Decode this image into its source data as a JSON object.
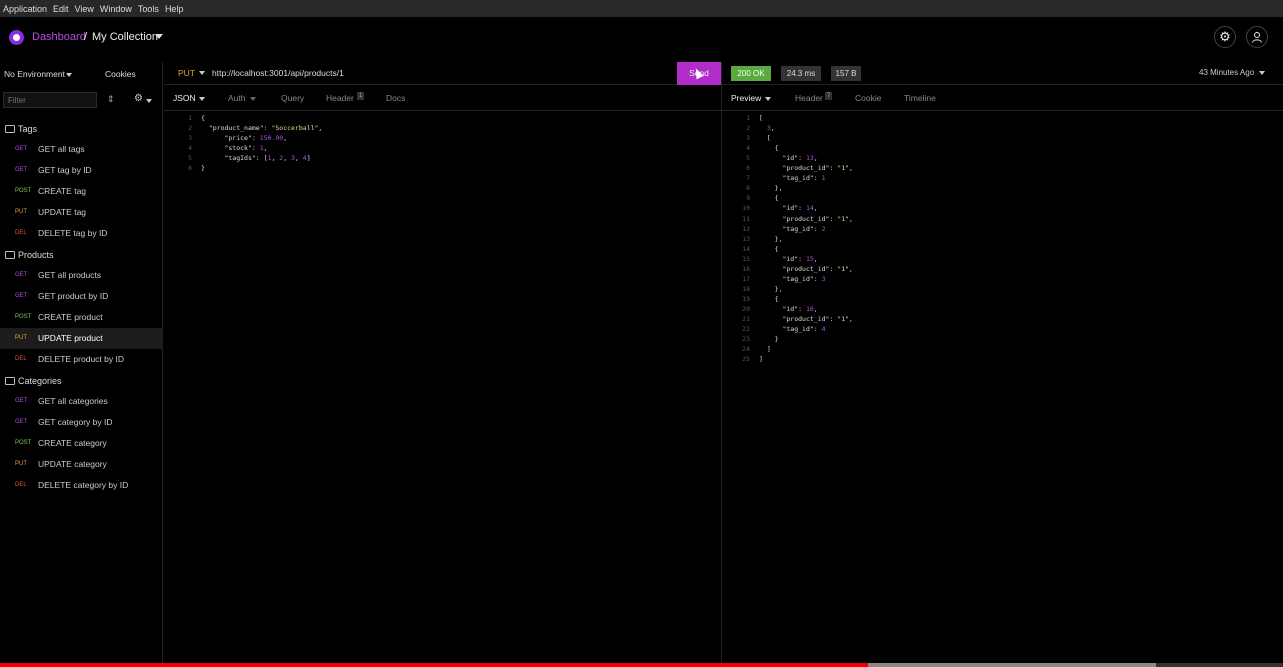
{
  "menu": [
    "Application",
    "Edit",
    "View",
    "Window",
    "Tools",
    "Help"
  ],
  "breadcrumb": {
    "dashboard": "Dashboard",
    "separator": "/",
    "collection": "My Collection"
  },
  "topbar": {
    "settings_icon": "gear-icon",
    "account_icon": "user-icon"
  },
  "sidebar": {
    "environment": "No Environment",
    "cookies": "Cookies",
    "filter_placeholder": "Filter",
    "folders": [
      {
        "name": "Tags",
        "requests": [
          {
            "method": "GET",
            "label": "GET all tags"
          },
          {
            "method": "GET",
            "label": "GET tag by ID"
          },
          {
            "method": "POST",
            "label": "CREATE tag"
          },
          {
            "method": "PUT",
            "label": "UPDATE tag"
          },
          {
            "method": "DEL",
            "label": "DELETE tag by ID"
          }
        ]
      },
      {
        "name": "Products",
        "requests": [
          {
            "method": "GET",
            "label": "GET all products"
          },
          {
            "method": "GET",
            "label": "GET product by ID"
          },
          {
            "method": "POST",
            "label": "CREATE product"
          },
          {
            "method": "PUT",
            "label": "UPDATE product"
          },
          {
            "method": "DEL",
            "label": "DELETE product by ID"
          }
        ]
      },
      {
        "name": "Categories",
        "requests": [
          {
            "method": "GET",
            "label": "GET all categories"
          },
          {
            "method": "GET",
            "label": "GET category by ID"
          },
          {
            "method": "POST",
            "label": "CREATE category"
          },
          {
            "method": "PUT",
            "label": "UPDATE category"
          },
          {
            "method": "DEL",
            "label": "DELETE category by ID"
          }
        ]
      }
    ]
  },
  "request": {
    "method": "PUT",
    "url": "http://localhost:3001/api/products/1",
    "send_label": "Send",
    "tabs": {
      "body": "JSON",
      "auth": "Auth",
      "query": "Query",
      "header": "Header",
      "header_count": "1",
      "docs": "Docs"
    },
    "body_lines": [
      "{",
      "  \"product_name\": \"Soccerball\",",
      "      \"price\": 150.00,",
      "      \"stock\": 1,",
      "      \"tagIds\": [1, 2, 3, 4]",
      "}"
    ]
  },
  "response": {
    "status": "200 OK",
    "time": "24.3 ms",
    "size": "157 B",
    "ago": "43 Minutes Ago",
    "tabs": {
      "preview": "Preview",
      "header": "Header",
      "header_count": "7",
      "cookie": "Cookie",
      "timeline": "Timeline"
    },
    "body_lines": [
      "[",
      "  3,",
      "  [",
      "    {",
      "      \"id\": 13,",
      "      \"product_id\": \"1\",",
      "      \"tag_id\": 1",
      "    },",
      "    {",
      "      \"id\": 14,",
      "      \"product_id\": \"1\",",
      "      \"tag_id\": 2",
      "    },",
      "    {",
      "      \"id\": 15,",
      "      \"product_id\": \"1\",",
      "      \"tag_id\": 3",
      "    },",
      "    {",
      "      \"id\": 16,",
      "      \"product_id\": \"1\",",
      "      \"tag_id\": 4",
      "    }",
      "  ]",
      "]"
    ]
  },
  "colors": {
    "accent": "#b12cc9",
    "ok": "#5aaa3f",
    "get": "#b44fe0",
    "post": "#7bc95b",
    "put": "#e8a33d",
    "del": "#e0513d"
  }
}
